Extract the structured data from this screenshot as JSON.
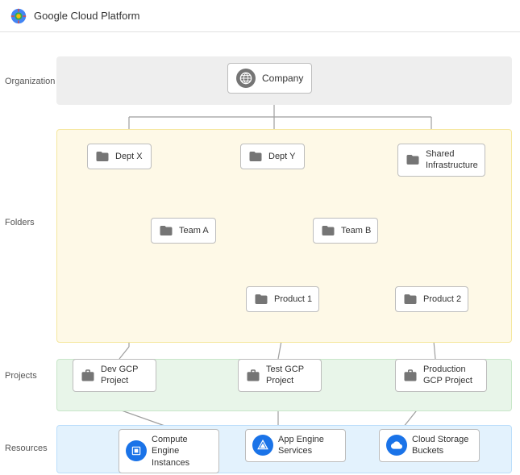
{
  "header": {
    "title": "Google Cloud Platform",
    "logo_alt": "GCP Logo"
  },
  "layers": {
    "organization": "Organization",
    "folders": "Folders",
    "projects": "Projects",
    "resources": "Resources"
  },
  "nodes": {
    "company": "Company",
    "dept_x": "Dept X",
    "dept_y": "Dept Y",
    "shared_infrastructure": "Shared\nInfrastructure",
    "team_a": "Team A",
    "team_b": "Team B",
    "product_1": "Product 1",
    "product_2": "Product 2",
    "dev_gcp": "Dev GCP\nProject",
    "test_gcp": "Test GCP\nProject",
    "prod_gcp": "Production\nGCP Project",
    "compute_engine": "Compute Engine\nInstances",
    "app_engine": "App Engine\nServices",
    "cloud_storage": "Cloud Storage\nBuckets"
  }
}
